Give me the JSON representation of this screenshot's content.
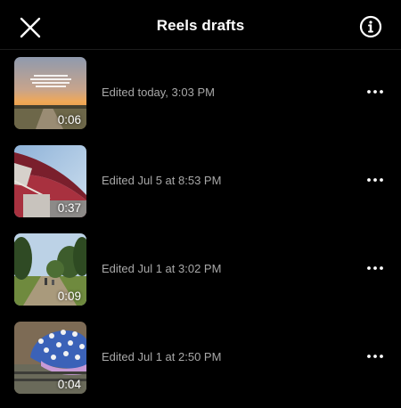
{
  "header": {
    "title": "Reels drafts",
    "close_icon": "close-icon",
    "info_icon": "info-icon"
  },
  "drafts": [
    {
      "edited": "Edited today, 3:03 PM",
      "duration": "0:06",
      "thumbnail": "sunset-road-with-text"
    },
    {
      "edited": "Edited Jul 5 at 8:53 PM",
      "duration": "0:37",
      "thumbnail": "red-umbrella-sky"
    },
    {
      "edited": "Edited Jul 1 at 3:02 PM",
      "duration": "0:09",
      "thumbnail": "trees-dirt-path"
    },
    {
      "edited": "Edited Jul 1 at 2:50 PM",
      "duration": "0:04",
      "thumbnail": "polka-dot-umbrella"
    }
  ],
  "colors": {
    "background": "#000000",
    "text": "#ffffff",
    "secondary_text": "#a8a8a8"
  }
}
